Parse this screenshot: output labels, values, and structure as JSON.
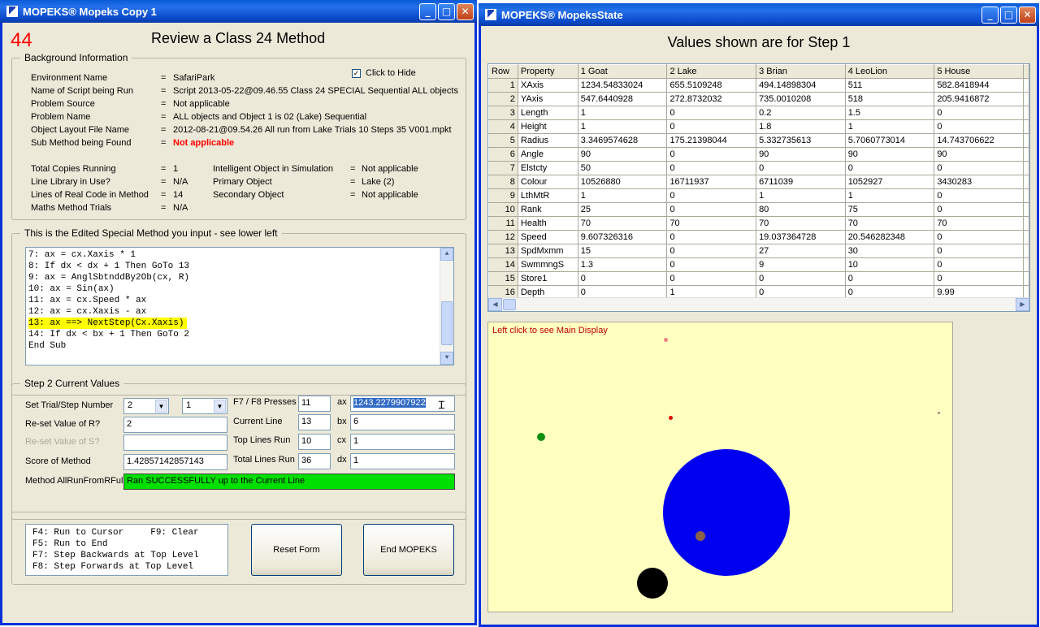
{
  "left_window": {
    "title": "MOPEKS® Mopeks Copy 1",
    "counter": "44",
    "heading": "Review a Class 24 Method",
    "background": {
      "legend": "Background Information",
      "hide_label": "Click to Hide",
      "hide_checked": true,
      "rows": [
        {
          "label": "Environment Name",
          "value": "SafariPark"
        },
        {
          "label": "Name of Script being Run",
          "value": "Script 2013-05-22@09.46.55 Class 24 SPECIAL Sequential ALL objects"
        },
        {
          "label": "Problem Source",
          "value": "Not applicable"
        },
        {
          "label": "Problem Name",
          "value": "ALL objects and Object 1 is 02 (Lake) Sequential"
        },
        {
          "label": "Object Layout File Name",
          "value": "2012-08-21@09.54.26 All run from Lake Trials 10 Steps 35 V001.mpkt"
        },
        {
          "label": "Sub Method being Found",
          "value": "Not applicable"
        }
      ],
      "stats_left": [
        {
          "label": "Total Copies Running",
          "value": "1"
        },
        {
          "label": "Line Library in Use?",
          "value": "N/A"
        },
        {
          "label": "Lines of Real Code in Method",
          "value": "14"
        },
        {
          "label": "Maths Method Trials",
          "value": "N/A"
        }
      ],
      "stats_right": [
        {
          "label": "Intelligent Object in Simulation",
          "value": "Not applicable"
        },
        {
          "label": "Primary Object",
          "value": "Lake (2)"
        },
        {
          "label": "Secondary Object",
          "value": "Not applicable"
        }
      ],
      "equals": "="
    },
    "code": {
      "legend": "This is the Edited Special Method you input - see lower left",
      "lines": [
        "7: ax = cx.Xaxis * 1",
        "8: If dx < dx + 1 Then GoTo 13",
        "9: ax = AnglSbtnddBy2Ob(cx, R)",
        "10: ax = Sin(ax)",
        "11: ax = cx.Speed * ax",
        "12: ax = cx.Xaxis - ax",
        "13: ax ==> NextStep(Cx.Xaxis)",
        "14: If dx < bx + 1 Then GoTo 2",
        "End Sub"
      ],
      "highlight_index": 6
    },
    "step": {
      "legend": "Step 2   Current Values",
      "set_trial_label": "Set Trial/Step Number",
      "trial_value": "2",
      "step_value": "1",
      "reset_r_label": "Re-set Value of R?",
      "reset_r_value": "2",
      "reset_s_label": "Re-set Value of S?",
      "reset_s_value": "",
      "score_label": "Score of Method",
      "score_value": "1.42857142857143",
      "method_label": "Method AllRunFromRFull",
      "method_status": "Ran SUCCESSFULLY up to the Current Line",
      "f7f8_label": "F7 / F8 Presses",
      "f7f8_value": "11",
      "current_line_label": "Current Line",
      "current_line_value": "13",
      "top_lines_label": "Top Lines Run",
      "top_lines_value": "10",
      "total_lines_label": "Total Lines Run",
      "total_lines_value": "36",
      "ax_label": "ax",
      "ax_value": "1243.2279907922",
      "bx_label": "bx",
      "bx_value": "6",
      "cx_label": "cx",
      "cx_value": "1",
      "dx_label": "dx",
      "dx_value": "1"
    },
    "keys": [
      "F4: Run to Cursor     F9: Clear",
      "F5: Run to End",
      "F7: Step Backwards at Top Level",
      "F8: Step Forwards at Top Level"
    ],
    "reset_button": "Reset Form",
    "end_button": "End MOPEKS"
  },
  "right_window": {
    "title": "MOPEKS® MopeksState",
    "heading": "Values shown are for Step 1",
    "columns": [
      "Row",
      "Property",
      "1 Goat",
      "2 Lake",
      "3 Brian",
      "4 LeoLion",
      "5 House"
    ],
    "rows": [
      [
        "1",
        "XAxis",
        "1234.54833024",
        "655.5109248",
        "494.14898304",
        "511",
        "582.8418944"
      ],
      [
        "2",
        "YAxis",
        "547.6440928",
        "272.8732032",
        "735.0010208",
        "518",
        "205.9416872"
      ],
      [
        "3",
        "Length",
        "1",
        "0",
        "0.2",
        "1.5",
        "0"
      ],
      [
        "4",
        "Height",
        "1",
        "0",
        "1.8",
        "1",
        "0"
      ],
      [
        "5",
        "Radius",
        "3.3469574628",
        "175.21398044",
        "5.332735613",
        "5.7060773014",
        "14.743706622"
      ],
      [
        "6",
        "Angle",
        "90",
        "0",
        "90",
        "90",
        "90"
      ],
      [
        "7",
        "Elstcty",
        "50",
        "0",
        "0",
        "0",
        "0"
      ],
      [
        "8",
        "Colour",
        "10526880",
        "16711937",
        "6711039",
        "1052927",
        "3430283"
      ],
      [
        "9",
        "LthMtR",
        "1",
        "0",
        "1",
        "1",
        "0"
      ],
      [
        "10",
        "Rank",
        "25",
        "0",
        "80",
        "75",
        "0"
      ],
      [
        "11",
        "Health",
        "70",
        "70",
        "70",
        "70",
        "70"
      ],
      [
        "12",
        "Speed",
        "9.607326316",
        "0",
        "19.037364728",
        "20.546282348",
        "0"
      ],
      [
        "13",
        "SpdMxmm",
        "15",
        "0",
        "27",
        "30",
        "0"
      ],
      [
        "14",
        "SwmmngS",
        "1.3",
        "0",
        "9",
        "10",
        "0"
      ],
      [
        "15",
        "Store1",
        "0",
        "0",
        "0",
        "0",
        "0"
      ],
      [
        "16",
        "Depth",
        "0",
        "1",
        "0",
        "0",
        "9.99"
      ]
    ],
    "display_hint": "Left click to see Main Display",
    "display_bg": "#ffffc0"
  }
}
